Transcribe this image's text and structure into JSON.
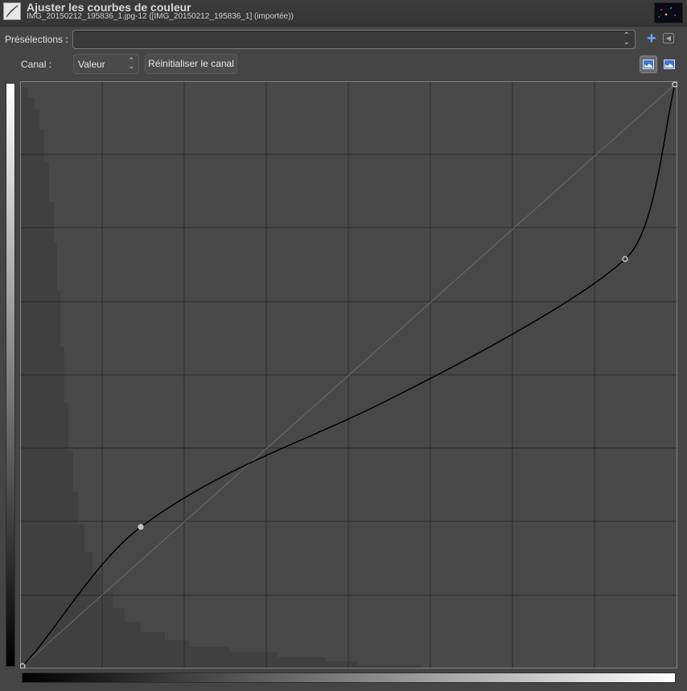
{
  "window": {
    "title": "Ajuster les courbes de couleur",
    "subtitle": "IMG_20150212_195836_1.jpg-12 ([IMG_20150212_195836_1] (importée))"
  },
  "presets": {
    "label": "Présélections :",
    "value": "",
    "add_icon": "plus-icon",
    "menu_icon": "tab-menu-icon"
  },
  "channel": {
    "label": "Canal :",
    "value": "Valeur",
    "reset_label": "Réinitialiser le canal"
  },
  "histogram_scale": {
    "linear_icon": "linear-histogram-icon",
    "log_icon": "log-histogram-icon",
    "active": "linear"
  },
  "colors": {
    "background": "#454545",
    "curve": "#000000",
    "add_icon": "#6fa8ff"
  }
}
